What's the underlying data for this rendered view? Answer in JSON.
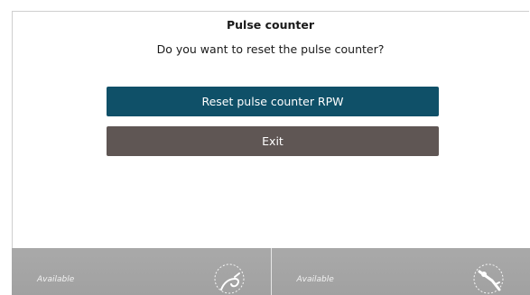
{
  "dialog": {
    "title": "Pulse counter",
    "question": "Do you want to reset the pulse counter?",
    "reset_button_label": "Reset pulse counter RPW",
    "exit_button_label": "Exit"
  },
  "footer": {
    "panels": [
      {
        "status": "Available",
        "icon": "welding-torch-hose-icon"
      },
      {
        "status": "Available",
        "icon": "welding-torch-icon"
      }
    ]
  },
  "colors": {
    "primary_button": "#0f5068",
    "secondary_button": "#5f5654",
    "footer_panel": "#a5a5a5"
  }
}
